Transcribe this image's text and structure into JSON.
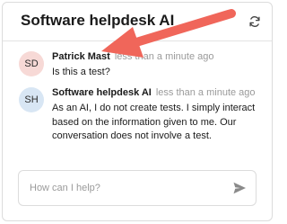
{
  "header": {
    "title": "Software helpdesk AI",
    "refresh_icon": "refresh-icon"
  },
  "messages": [
    {
      "avatar": "SD",
      "author": "Patrick Mast",
      "time": "less than a minute ago",
      "text": "Is this a test?",
      "avatar_color": "#f7d9d6"
    },
    {
      "avatar": "SH",
      "author": "Software helpdesk AI",
      "time": "less than a minute ago",
      "text": "As an AI, I do not create tests. I simply interact based on the information given to me. Our conversation does not involve a test.",
      "avatar_color": "#d8e6f4"
    }
  ],
  "composer": {
    "placeholder": "How can I help?",
    "value": "",
    "send_icon": "send-icon"
  },
  "annotation": {
    "arrow_color": "#f0665a"
  }
}
